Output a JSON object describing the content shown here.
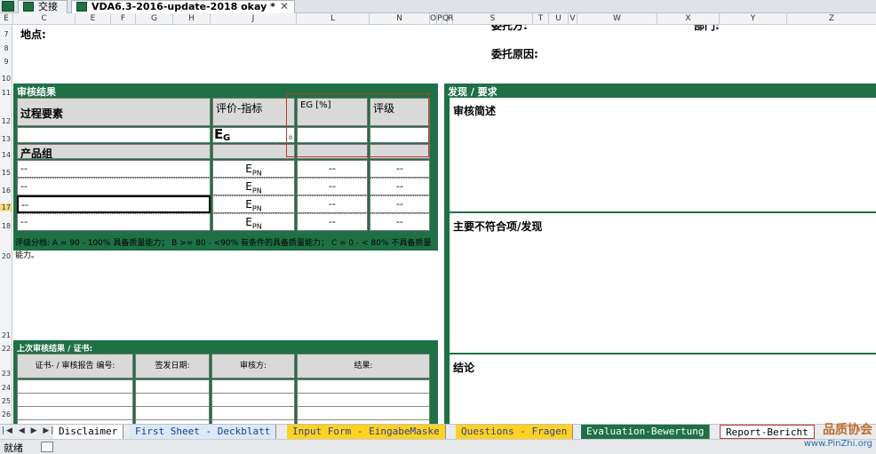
{
  "window": {
    "tabs": [
      {
        "label": "交接",
        "active": false
      },
      {
        "label": "VDA6.3-2016-update-2018 okay *",
        "active": true
      }
    ],
    "close_glyph": "✕"
  },
  "columns": [
    "E",
    "C",
    "E",
    "F",
    "G",
    "H",
    "J",
    "L",
    "N",
    "O",
    "P",
    "Q",
    "R",
    "S",
    "T",
    "U",
    "V",
    "W",
    "X",
    "Y",
    "Z"
  ],
  "rows": [
    "7",
    "8",
    "9",
    "10",
    "11",
    "12",
    "13",
    "14",
    "15",
    "16",
    "17",
    "18",
    "20",
    "21",
    "22",
    "23",
    "24",
    "25",
    "26"
  ],
  "header_fields": {
    "location_label": "地点:",
    "reason_label": "委托原因:",
    "client_label": "委托方:",
    "dept_label": "部门:"
  },
  "audit_result": {
    "title": "审核结果",
    "col_process": "过程要素",
    "col_indicator": "评价-指标",
    "col_eg": "EG [%]",
    "col_grade": "评级",
    "eg_symbol": "E",
    "eg_sub": "G",
    "eg_small": "0",
    "product_group_label": "产品组",
    "rows": [
      {
        "name": "--",
        "sym": "E",
        "sub": "PN",
        "eg": "--",
        "grade": "--"
      },
      {
        "name": "--",
        "sym": "E",
        "sub": "PN",
        "eg": "--",
        "grade": "--"
      },
      {
        "name": "--",
        "sym": "E",
        "sub": "PN",
        "eg": "--",
        "grade": "--"
      },
      {
        "name": "--",
        "sym": "E",
        "sub": "PN",
        "eg": "--",
        "grade": "--"
      }
    ],
    "grading_note": "评级分档: A = 90 - 100% 具备质量能力； B >= 80 - <90% 有条件的具备质量能力； C = 0 - < 80% 不具备质量能力。"
  },
  "last_audit": {
    "title": "上次审核结果 / 证书:",
    "col_cert": "证书- / 审核报告 编号:",
    "col_date": "签发日期:",
    "col_auditor": "审核方:",
    "col_result": "结果:"
  },
  "findings": {
    "title": "发现 / 要求",
    "summary_label": "审核简述",
    "nonconformity_label": "主要不符合项/发现",
    "conclusion_label": "结论"
  },
  "sheet_tabs": [
    {
      "label": "Disclaimer",
      "style": "white"
    },
    {
      "label": "First Sheet - Deckblatt",
      "style": "blue"
    },
    {
      "label": "Input Form - EingabeMaske",
      "style": "yellow"
    },
    {
      "label": "Questions - Fragen",
      "style": "yellow"
    },
    {
      "label": "Evaluation-Bewertung",
      "style": "green"
    },
    {
      "label": "Report-Bericht",
      "style": "white"
    }
  ],
  "nav_buttons": "|◀ ◀ ▶ ▶|",
  "status": {
    "ready": "就绪"
  },
  "watermark": {
    "brand": "品质协会",
    "url": "www.PinZhi.org"
  }
}
